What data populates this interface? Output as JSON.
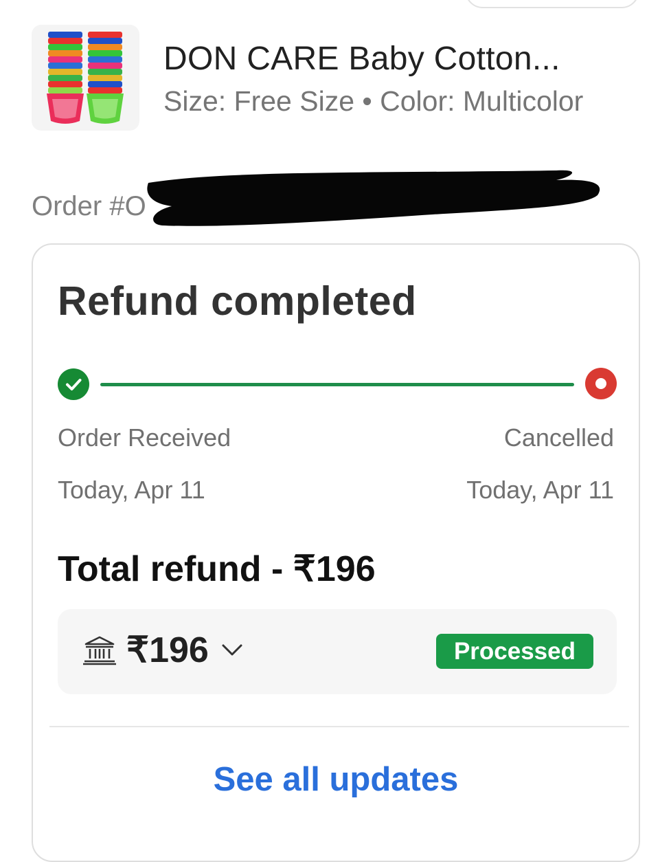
{
  "product": {
    "title": "DON CARE Baby Cotton...",
    "meta": "Size: Free Size • Color: Multicolor",
    "thumbnail_icon": "cloth-diapers-image"
  },
  "order": {
    "label": "Order #O"
  },
  "status_card": {
    "title": "Refund completed",
    "steps": [
      {
        "label": "Order Received",
        "date": "Today, Apr 11",
        "state": "done",
        "color": "#168a34"
      },
      {
        "label": "Cancelled",
        "date": "Today, Apr 11",
        "state": "cancelled",
        "color": "#d93a32"
      }
    ],
    "total_refund": "Total refund - ₹196",
    "refund": {
      "method_icon": "bank-icon",
      "amount": "₹196",
      "status": "Processed",
      "status_color": "#1a9b48"
    },
    "see_all": "See all updates",
    "link_color": "#2a6fdb"
  }
}
